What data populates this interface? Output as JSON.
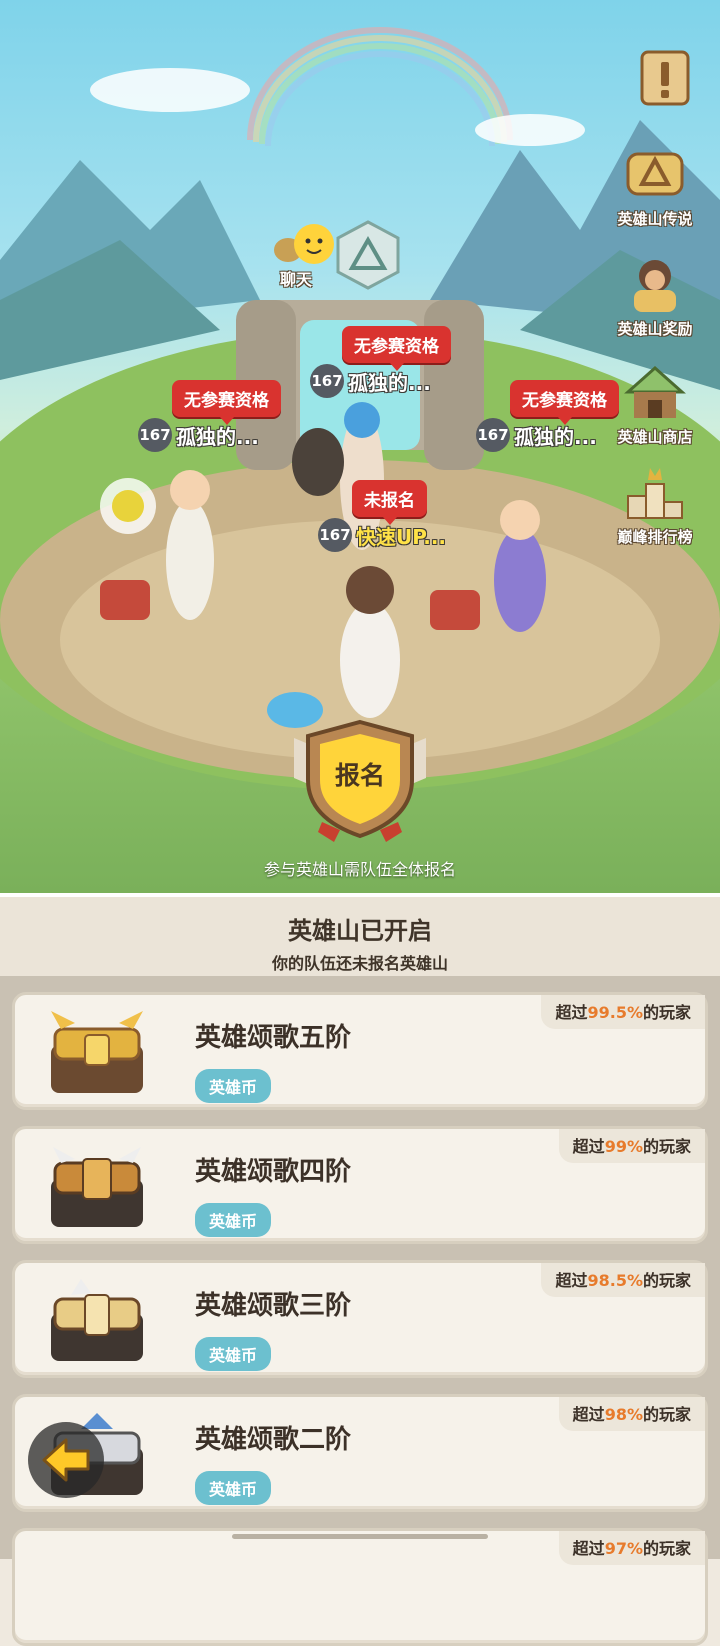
{
  "side_menu": [
    {
      "id": "info",
      "label": "",
      "icon": "scroll-exclamation-icon"
    },
    {
      "id": "legend",
      "label": "英雄山传说",
      "icon": "hero-mountain-scroll-icon"
    },
    {
      "id": "reward",
      "label": "英雄山奖励",
      "icon": "caveman-icon"
    },
    {
      "id": "shop",
      "label": "英雄山商店",
      "icon": "hut-shop-icon"
    },
    {
      "id": "rank",
      "label": "巅峰排行榜",
      "icon": "podium-icon"
    }
  ],
  "chat": {
    "label": "聊天"
  },
  "players": [
    {
      "status": "无参赛资格",
      "level": "167",
      "name": "孤独的..."
    },
    {
      "status": "无参赛资格",
      "level": "167",
      "name": "孤独的..."
    },
    {
      "status": "无参赛资格",
      "level": "167",
      "name": "孤独的..."
    },
    {
      "status": "未报名",
      "level": "167",
      "name": "快速UP..."
    }
  ],
  "signup": {
    "label": "报名",
    "hint": "参与英雄山需队伍全体报名"
  },
  "panel": {
    "title": "英雄山已开启",
    "subtitle": "你的队伍还未报名英雄山"
  },
  "tiers": [
    {
      "name": "英雄颂歌五阶",
      "currency": "英雄币",
      "pct_prefix": "超过",
      "pct": "99.5%",
      "pct_suffix": "的玩家",
      "color": "#e3b340"
    },
    {
      "name": "英雄颂歌四阶",
      "currency": "英雄币",
      "pct_prefix": "超过",
      "pct": "99%",
      "pct_suffix": "的玩家",
      "color": "#c98a3a"
    },
    {
      "name": "英雄颂歌三阶",
      "currency": "英雄币",
      "pct_prefix": "超过",
      "pct": "98.5%",
      "pct_suffix": "的玩家",
      "color": "#e8cc86"
    },
    {
      "name": "英雄颂歌二阶",
      "currency": "英雄币",
      "pct_prefix": "超过",
      "pct": "98%",
      "pct_suffix": "的玩家",
      "color": "#d7d9de"
    },
    {
      "name": "",
      "currency": "",
      "pct_prefix": "超过",
      "pct": "97%",
      "pct_suffix": "的玩家",
      "color": "#d7d9de"
    }
  ],
  "colors": {
    "accent_red": "#d9332f",
    "badge_blue": "#6cc0cf",
    "pct_orange": "#e77b2c"
  }
}
